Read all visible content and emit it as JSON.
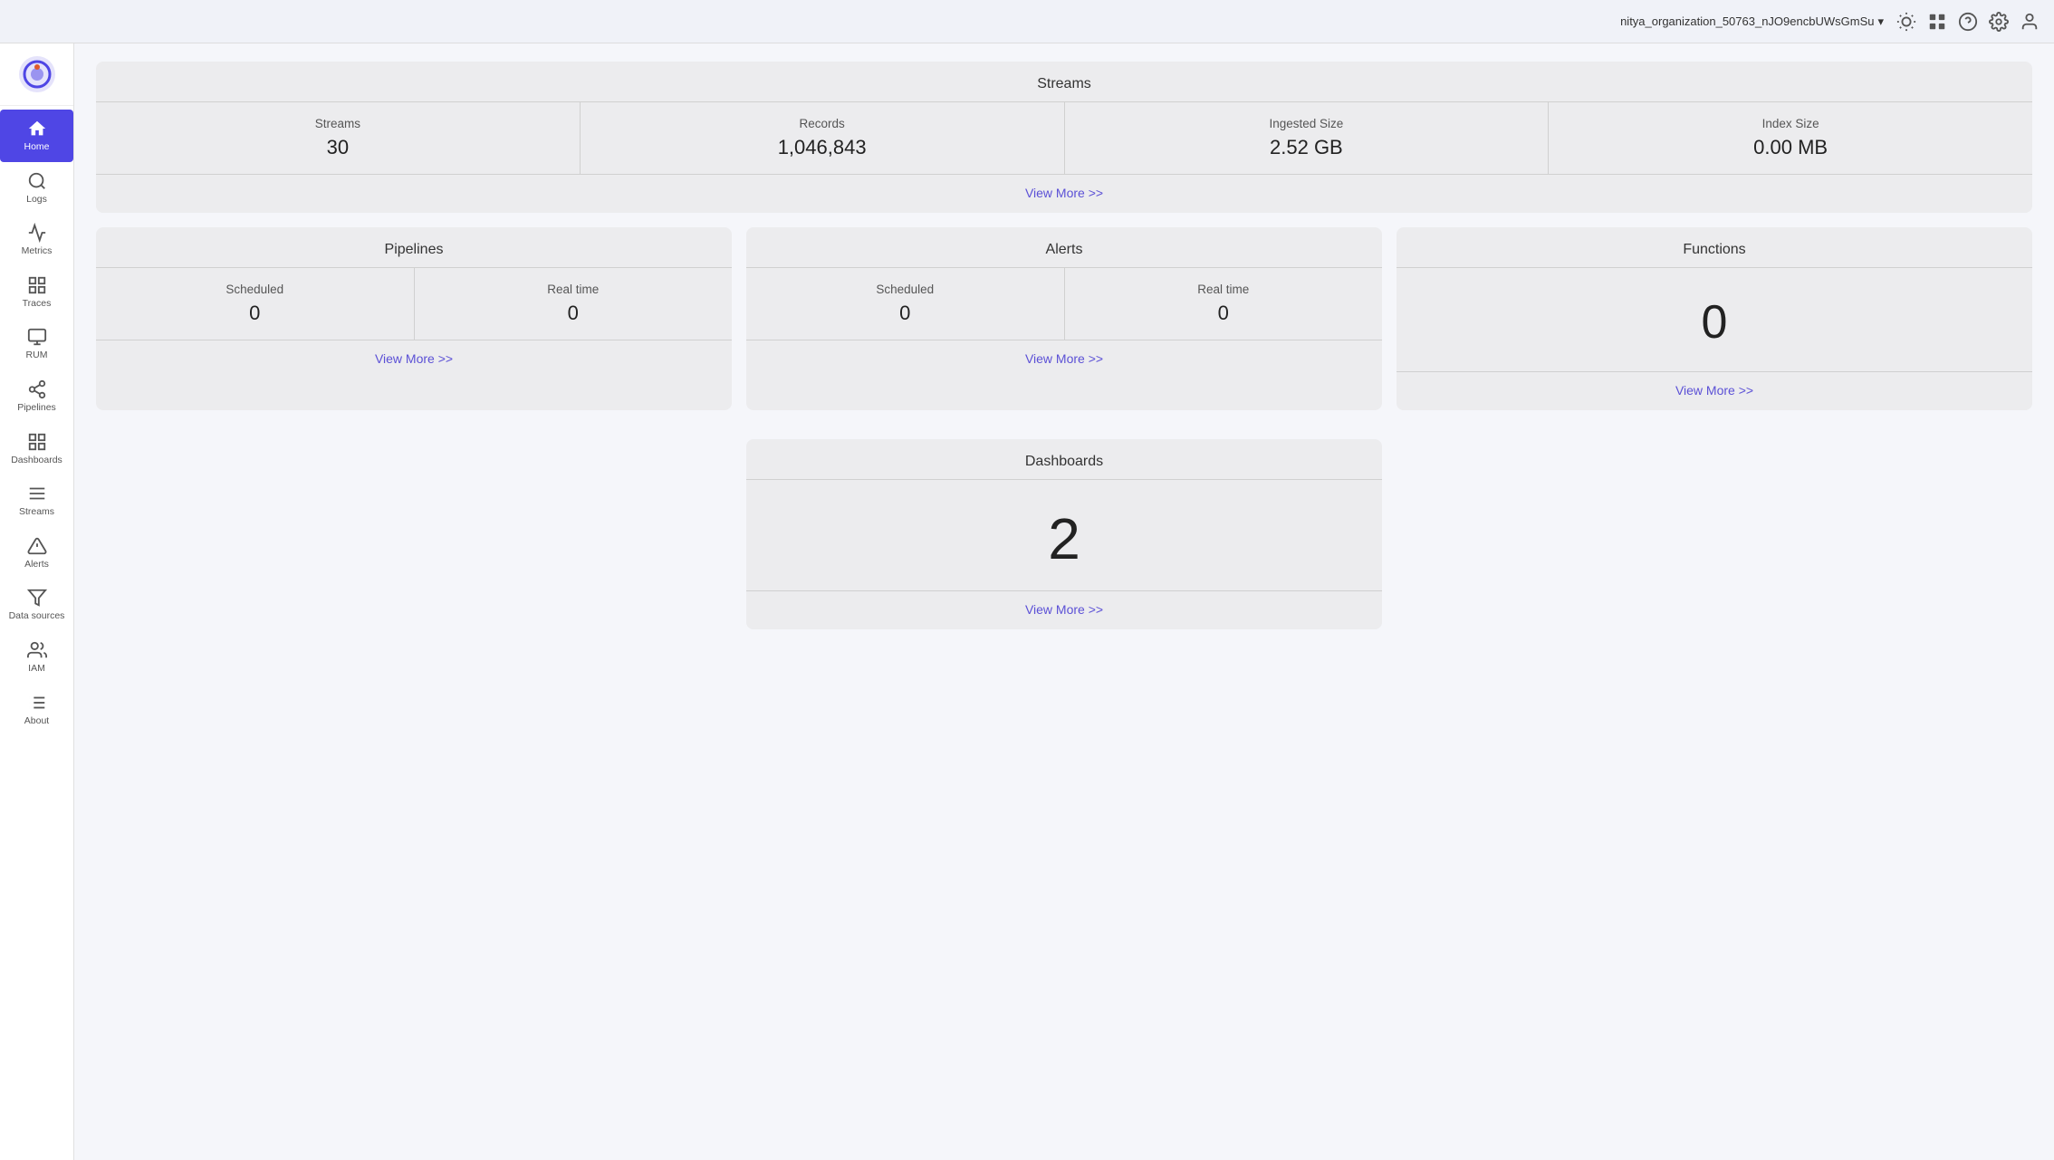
{
  "header": {
    "org_name": "nitya_organization_50763_nJO9encbUWsGmSu",
    "org_dropdown_label": "nitya_organization_50763_nJO9encbUWsGmSu"
  },
  "sidebar": {
    "items": [
      {
        "id": "home",
        "label": "Home",
        "active": true
      },
      {
        "id": "logs",
        "label": "Logs",
        "active": false
      },
      {
        "id": "metrics",
        "label": "Metrics",
        "active": false
      },
      {
        "id": "traces",
        "label": "Traces",
        "active": false
      },
      {
        "id": "rum",
        "label": "RUM",
        "active": false
      },
      {
        "id": "pipelines",
        "label": "Pipelines",
        "active": false
      },
      {
        "id": "dashboards",
        "label": "Dashboards",
        "active": false
      },
      {
        "id": "streams",
        "label": "Streams",
        "active": false
      },
      {
        "id": "alerts",
        "label": "Alerts",
        "active": false
      },
      {
        "id": "datasources",
        "label": "Data sources",
        "active": false
      },
      {
        "id": "iam",
        "label": "IAM",
        "active": false
      },
      {
        "id": "about",
        "label": "About",
        "active": false
      }
    ]
  },
  "streams_card": {
    "title": "Streams",
    "stats": [
      {
        "label": "Streams",
        "value": "30"
      },
      {
        "label": "Records",
        "value": "1,046,843"
      },
      {
        "label": "Ingested Size",
        "value": "2.52 GB"
      },
      {
        "label": "Index Size",
        "value": "0.00 MB"
      }
    ],
    "view_more": "View More >>"
  },
  "pipelines_card": {
    "title": "Pipelines",
    "scheduled_label": "Scheduled",
    "scheduled_value": "0",
    "realtime_label": "Real time",
    "realtime_value": "0",
    "view_more": "View More >>"
  },
  "alerts_card": {
    "title": "Alerts",
    "scheduled_label": "Scheduled",
    "scheduled_value": "0",
    "realtime_label": "Real time",
    "realtime_value": "0",
    "view_more": "View More >>"
  },
  "functions_card": {
    "title": "Functions",
    "value": "0",
    "view_more": "View More >>"
  },
  "dashboards_card": {
    "title": "Dashboards",
    "value": "2",
    "view_more": "View More >>"
  }
}
